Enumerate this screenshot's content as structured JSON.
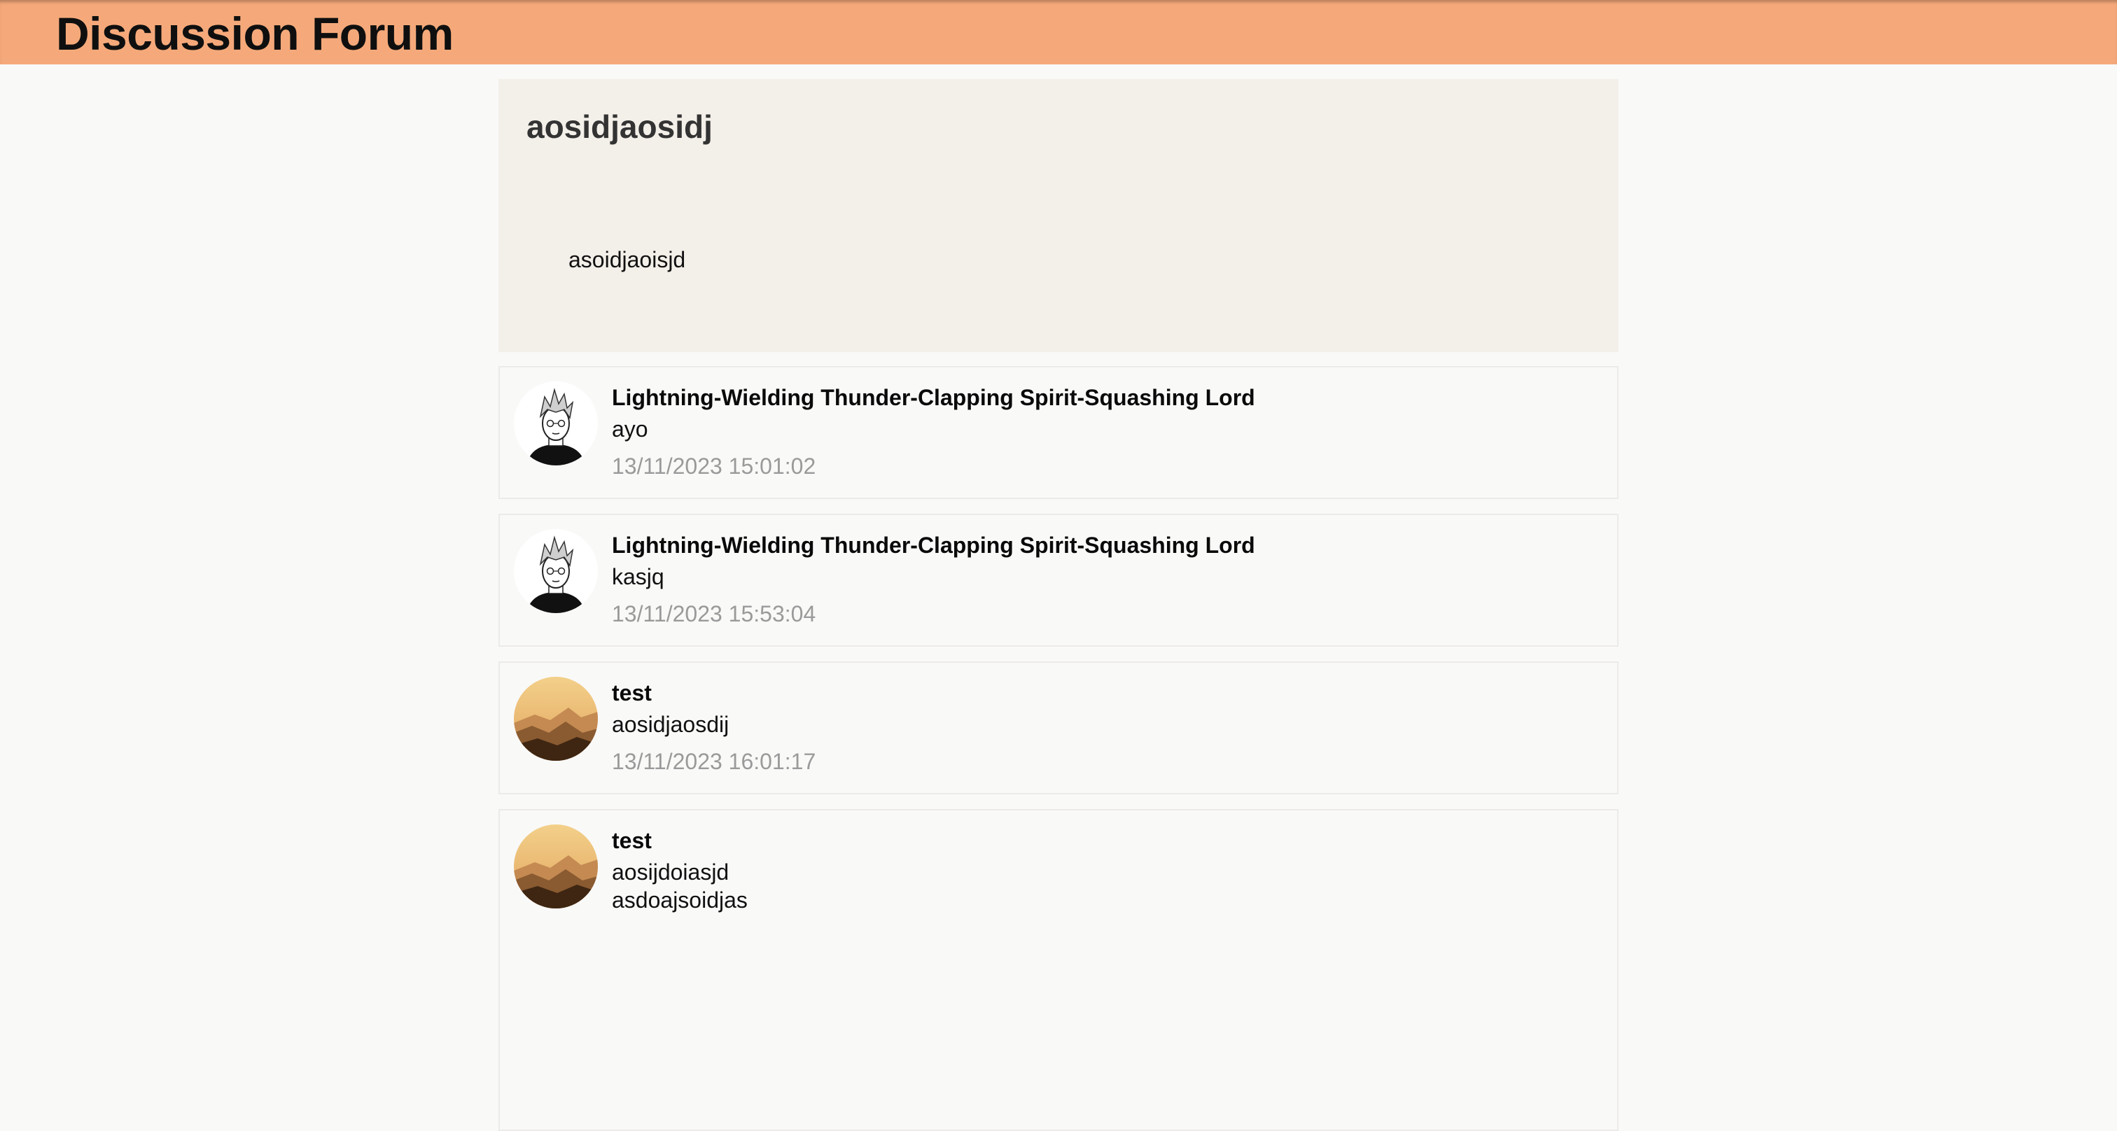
{
  "app": {
    "title": "Discussion Forum"
  },
  "thread": {
    "title": "aosidjaosidj",
    "body": "asoidjaoisjd"
  },
  "replies": [
    {
      "author": "Lightning-Wielding Thunder-Clapping Spirit-Squashing Lord",
      "avatar": "sketch-person-avatar",
      "text": "ayo",
      "timestamp": "13/11/2023 15:01:02"
    },
    {
      "author": "Lightning-Wielding Thunder-Clapping Spirit-Squashing Lord",
      "avatar": "sketch-person-avatar",
      "text": "kasjq",
      "timestamp": "13/11/2023 15:53:04"
    },
    {
      "author": "test",
      "avatar": "desert-mountain-avatar",
      "text": "aosidjaosdij",
      "timestamp": "13/11/2023 16:01:17"
    },
    {
      "author": "test",
      "avatar": "desert-mountain-avatar",
      "text": "aosijdoiasjd\nasdoajsoidjas"
    }
  ],
  "colors": {
    "header": "#f5a97a",
    "thread_card": "#f3efe9",
    "page_background": "#f9f9f8",
    "timestamp": "#9a9a9a"
  }
}
